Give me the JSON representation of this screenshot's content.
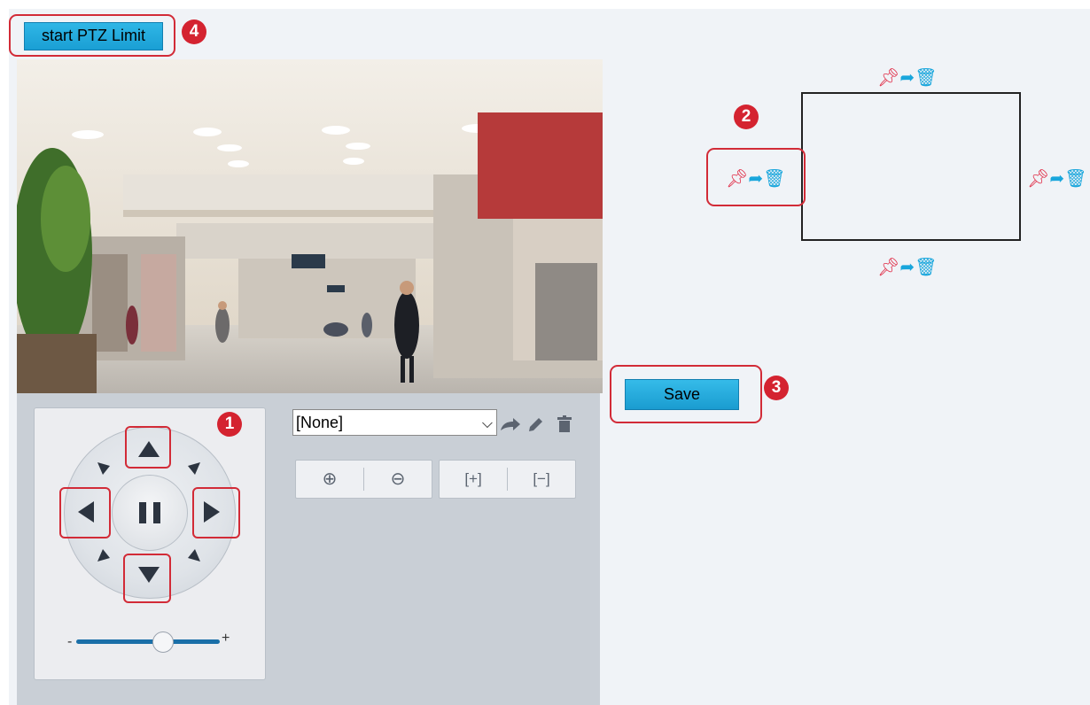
{
  "toolbar": {
    "start_ptz_limit_label": "start PTZ Limit"
  },
  "callouts": {
    "one": "1",
    "two": "2",
    "three": "3",
    "four": "4"
  },
  "preset": {
    "selected": "[None]"
  },
  "zoom_controls": [
    "zoom-in",
    "zoom-out",
    "focus-near",
    "focus-far"
  ],
  "limits": {
    "save_label": "Save"
  },
  "colors": {
    "accent": "#1a9fd4",
    "callout": "#d22b37",
    "pin": "#e0304a",
    "icon": "#19a6dc"
  }
}
